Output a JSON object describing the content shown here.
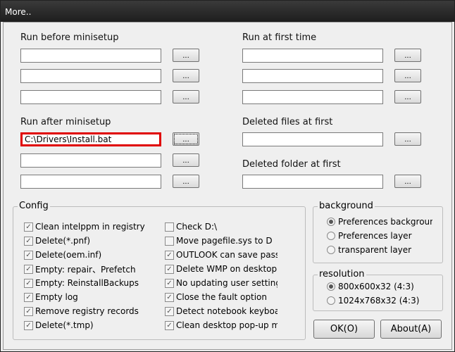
{
  "window": {
    "title": "More.."
  },
  "run_before": {
    "label": "Run before minisetup",
    "values": [
      "",
      "",
      ""
    ]
  },
  "run_first": {
    "label": "Run at first time",
    "values": [
      "",
      "",
      ""
    ]
  },
  "run_after": {
    "label": "Run after minisetup",
    "values": [
      "C:\\Drivers\\Install.bat",
      "",
      ""
    ]
  },
  "deleted_files": {
    "label": "Deleted files at first",
    "value": ""
  },
  "deleted_folder": {
    "label": "Deleted folder at first",
    "value": ""
  },
  "browse_label": "...",
  "config": {
    "title": "Config",
    "items": [
      {
        "label": "Clean intelppm in registry",
        "checked": true
      },
      {
        "label": "Delete(*.pnf)",
        "checked": true
      },
      {
        "label": "Delete(oem.inf)",
        "checked": true
      },
      {
        "label": "Empty: repair、Prefetch",
        "checked": true
      },
      {
        "label": "Empty: ReinstallBackups",
        "checked": true
      },
      {
        "label": "Empty log",
        "checked": true
      },
      {
        "label": "Remove registry records",
        "checked": true
      },
      {
        "label": "Delete(*.tmp)",
        "checked": true
      },
      {
        "label": "Check D:\\",
        "checked": false
      },
      {
        "label": "Move pagefile.sys to D",
        "checked": false
      },
      {
        "label": "OUTLOOK can save password",
        "checked": true
      },
      {
        "label": "Delete WMP on desktop",
        "checked": true
      },
      {
        "label": "No updating user settings",
        "checked": true
      },
      {
        "label": "Close the fault option",
        "checked": true
      },
      {
        "label": "Detect notebook keyboard",
        "checked": true
      },
      {
        "label": "Clean desktop pop-up menu",
        "checked": true
      }
    ]
  },
  "background": {
    "title": "background",
    "options": [
      {
        "label": "Preferences background",
        "selected": true
      },
      {
        "label": "Preferences layer",
        "selected": false
      },
      {
        "label": "transparent layer",
        "selected": false
      }
    ]
  },
  "resolution": {
    "title": "resolution",
    "options": [
      {
        "label": "800x600x32  (4:3)",
        "selected": true
      },
      {
        "label": "1024x768x32 (4:3)",
        "selected": false
      }
    ]
  },
  "buttons": {
    "ok": "OK(O)",
    "about": "About(A)"
  }
}
